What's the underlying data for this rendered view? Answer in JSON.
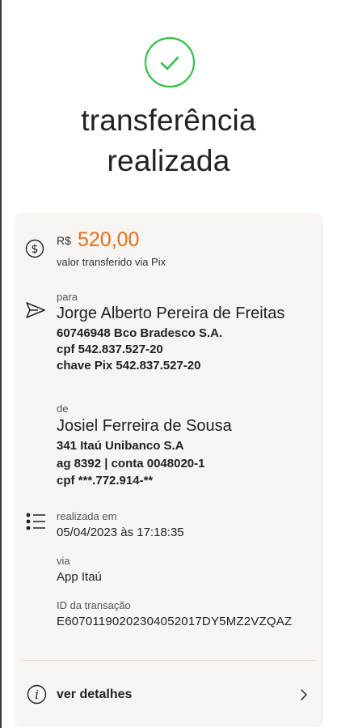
{
  "header": {
    "title_line1": "transferência",
    "title_line2": "realizada"
  },
  "colors": {
    "success": "#2fbf45",
    "amount": "#e0701e",
    "card_bg": "#f7f4f1"
  },
  "amount": {
    "currency": "R$",
    "value": "520,00",
    "caption": "valor transferido via Pix"
  },
  "recipient": {
    "label": "para",
    "name": "Jorge Alberto Pereira de Freitas",
    "bank": "60746948 Bco Bradesco S.A.",
    "cpf": "cpf 542.837.527-20",
    "pix_key": "chave Pix 542.837.527-20"
  },
  "sender": {
    "label": "de",
    "name": "Josiel Ferreira de Sousa",
    "bank": "341 Itaú Unibanco S.A",
    "account": "ag 8392 | conta 0048020-1",
    "cpf": "cpf ***.772.914-**"
  },
  "info": {
    "date_label": "realizada em",
    "date_value": "05/04/2023 às 17:18:35",
    "via_label": "via",
    "via_value": "App Itaú",
    "id_label": "ID da transação",
    "id_value": "E60701190202304052017DY5MZ2VZQAZ"
  },
  "footer": {
    "details_label": "ver detalhes"
  },
  "icons": {
    "success": "check-circle-icon",
    "amount": "dollar-circle-icon",
    "send": "send-icon",
    "list": "list-icon",
    "info": "info-icon",
    "chevron": "chevron-right-icon"
  }
}
